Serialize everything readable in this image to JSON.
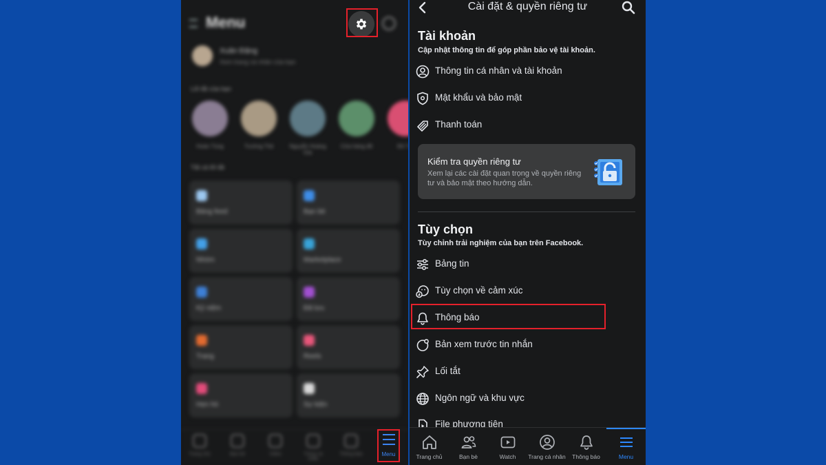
{
  "left_phone": {
    "title": "Menu",
    "profile_name": "Xuân Đặng",
    "profile_sub": "Xem trang cá nhân của bạn",
    "shortcuts_label": "Lối tắt của bạn",
    "stories": [
      "Hoàn Tùng",
      "Trường Thịt",
      "Nguyễn Hoàng Gia",
      "Cửa hàng đồ",
      "Đô Tài"
    ],
    "all_shortcuts_label": "Tất cả lối tắt",
    "cards": [
      "Bảng feed",
      "Bạn bè",
      "Nhóm",
      "Marketplace",
      "Kỷ niệm",
      "Đã lưu",
      "Trang",
      "Reels",
      "Hẹn hò",
      "Sự kiện"
    ],
    "nav": [
      "Trang chủ",
      "Bạn bè",
      "Video",
      "Trang cá nhân",
      "Thông báo"
    ],
    "menu_tab_label": "Menu"
  },
  "right_phone": {
    "header_title": "Cài đặt & quyền riêng tư",
    "account": {
      "title": "Tài khoản",
      "subtitle": "Cập nhật thông tin để góp phần bảo vệ tài khoản.",
      "items": [
        {
          "label": "Thông tin cá nhân và tài khoản",
          "icon": "person-circle-icon"
        },
        {
          "label": "Mật khẩu và bảo mật",
          "icon": "shield-icon"
        },
        {
          "label": "Thanh toán",
          "icon": "tag-icon"
        }
      ]
    },
    "privacy_card": {
      "title": "Kiểm tra quyền riêng tư",
      "description": "Xem lại các cài đặt quan trọng về quyền riêng tư và bảo mật theo hướng dẫn."
    },
    "preferences": {
      "title": "Tùy chọn",
      "subtitle": "Tùy chỉnh trải nghiệm của bạn trên Facebook.",
      "items": [
        {
          "label": "Bảng tin",
          "icon": "sliders-icon"
        },
        {
          "label": "Tùy chọn về cảm xúc",
          "icon": "reaction-icon"
        },
        {
          "label": "Thông báo",
          "icon": "bell-icon"
        },
        {
          "label": "Bản xem trước tin nhắn",
          "icon": "message-preview-icon"
        },
        {
          "label": "Lối tắt",
          "icon": "pin-icon"
        },
        {
          "label": "Ngôn ngữ và khu vực",
          "icon": "globe-icon"
        },
        {
          "label": "File phương tiện",
          "icon": "media-file-icon"
        }
      ]
    },
    "nav": [
      {
        "label": "Trang chủ",
        "icon": "home-icon"
      },
      {
        "label": "Bạn bè",
        "icon": "friends-icon"
      },
      {
        "label": "Watch",
        "icon": "watch-icon"
      },
      {
        "label": "Trang cá nhân",
        "icon": "profile-icon"
      },
      {
        "label": "Thông báo",
        "icon": "bell-icon"
      },
      {
        "label": "Menu",
        "icon": "menu-icon"
      }
    ]
  },
  "colors": {
    "background": "#0b4aa8",
    "phone_bg": "#18191a",
    "highlight": "#e5212b",
    "accent": "#2d88ff"
  }
}
